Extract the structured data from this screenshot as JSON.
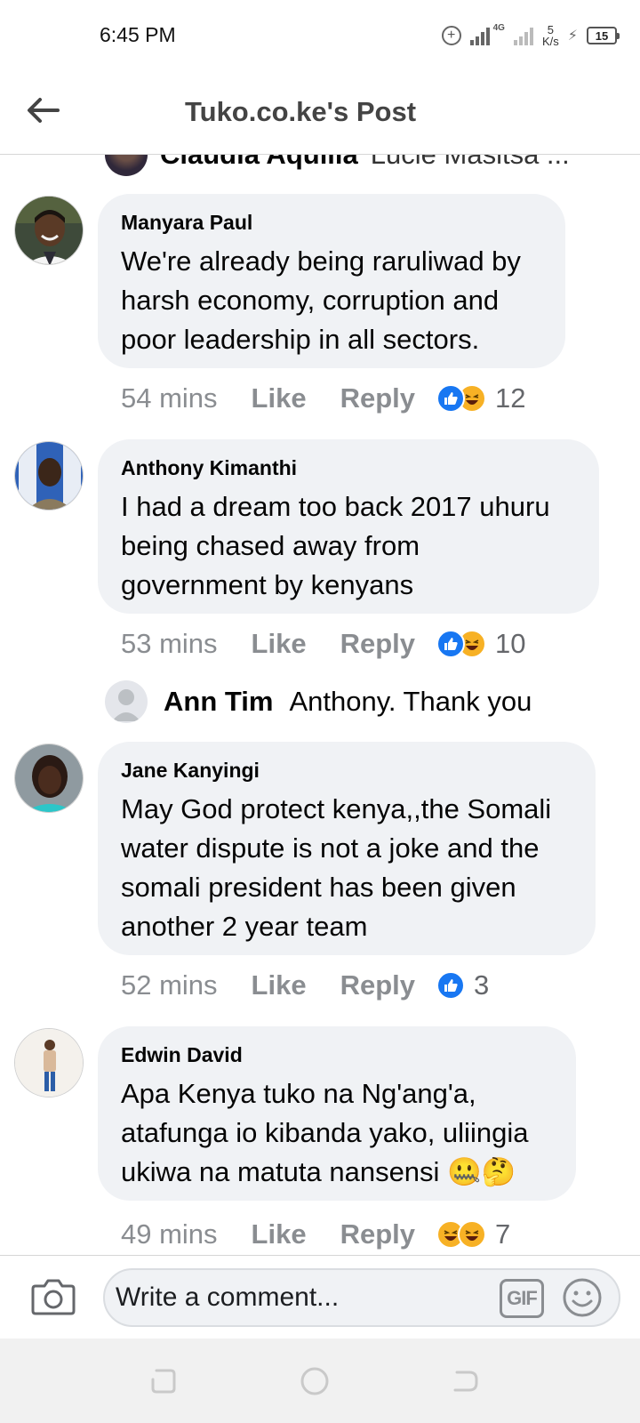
{
  "status_bar": {
    "time": "6:45 PM",
    "network_type": "4G",
    "speed_value": "5",
    "speed_unit": "K/s",
    "battery": "15"
  },
  "header": {
    "title": "Tuko.co.ke's Post"
  },
  "cut_off_reply": {
    "author": "Claudia Aquilia",
    "text": "Lucie Masitsa ..."
  },
  "comments": [
    {
      "author": "Manyara Paul",
      "text": "We're already being raruliwad by\nharsh economy, corruption and\npoor leadership in all sectors.",
      "time": "54 mins",
      "like": "Like",
      "reply": "Reply",
      "reaction_count": "12",
      "reactions": [
        "like-icon",
        "haha-icon"
      ]
    },
    {
      "author": "Anthony Kimanthi",
      "text": "I had a dream too back 2017 uhuru\nbeing chased away from\ngovernment by kenyans",
      "time": "53 mins",
      "like": "Like",
      "reply": "Reply",
      "reaction_count": "10",
      "reactions": [
        "like-icon",
        "haha-icon"
      ]
    },
    {
      "author": "Jane Kanyingi",
      "text": "May God protect kenya,,the Somali\nwater dispute is not a joke and the\nsomali president has been given\nanother 2 year team",
      "time": "52 mins",
      "like": "Like",
      "reply": "Reply",
      "reaction_count": "3",
      "reactions": [
        "like-icon"
      ]
    },
    {
      "author": "Edwin David",
      "text": "Apa Kenya tuko na Ng'ang'a,\natafunga io kibanda yako, uliingia\nukiwa na matuta nansensi 🤐🤔",
      "time": "49 mins",
      "like": "Like",
      "reply": "Reply",
      "reaction_count": "7",
      "reactions": [
        "haha-icon",
        "haha-icon"
      ]
    }
  ],
  "sub_reply": {
    "author": "Ann Tim",
    "text": "Anthony. Thank you"
  },
  "composer": {
    "placeholder": "Write a comment...",
    "gif_label": "GIF"
  },
  "colors": {
    "bubble": "#f0f2f5",
    "like_blue": "#1877f2",
    "haha_yellow": "#f7b125",
    "meta_gray": "#8a8d91"
  }
}
